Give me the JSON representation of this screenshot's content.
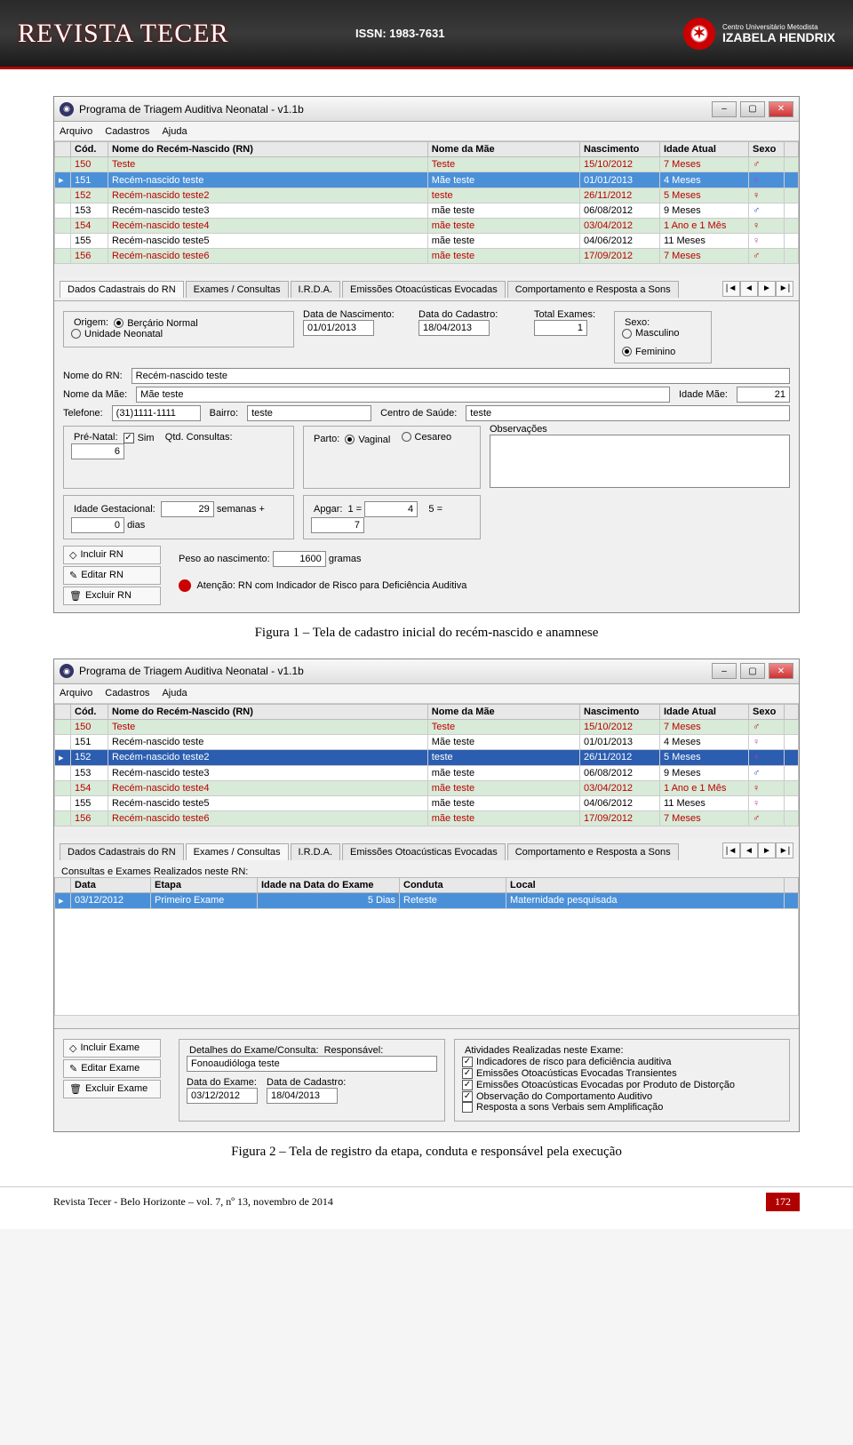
{
  "banner": {
    "title": "REVISTA TECER",
    "issn": "ISSN: 1983-7631",
    "logo_name": "IZABELA HENDRIX",
    "logo_sub": "Centro Universitário Metodista"
  },
  "fig1": {
    "window_title": "Programa de Triagem Auditiva Neonatal - v1.1b",
    "menus": [
      "Arquivo",
      "Cadastros",
      "Ajuda"
    ],
    "grid_headers": [
      "Cód.",
      "Nome do Recém-Nascido (RN)",
      "Nome da Mãe",
      "Nascimento",
      "Idade Atual",
      "Sexo"
    ],
    "grid_rows": [
      {
        "cod": "150",
        "nome": "Teste",
        "mae": "Teste",
        "nasc": "15/10/2012",
        "idade": "7 Meses",
        "sexo": "♂",
        "cls": "row-alt red-text",
        "sexcls": "sexo-m"
      },
      {
        "cod": "151",
        "nome": "Recém-nascido teste",
        "mae": "Mãe teste",
        "nasc": "01/01/2013",
        "idade": "4 Meses",
        "sexo": "♀",
        "cls": "row-sel",
        "sexcls": "sexo-f"
      },
      {
        "cod": "152",
        "nome": "Recém-nascido teste2",
        "mae": "teste",
        "nasc": "26/11/2012",
        "idade": "5 Meses",
        "sexo": "♀",
        "cls": "row-alt red-text",
        "sexcls": "sexo-f"
      },
      {
        "cod": "153",
        "nome": "Recém-nascido teste3",
        "mae": "mãe teste",
        "nasc": "06/08/2012",
        "idade": "9 Meses",
        "sexo": "♂",
        "cls": "",
        "sexcls": "sexo-m"
      },
      {
        "cod": "154",
        "nome": "Recém-nascido teste4",
        "mae": "mãe teste",
        "nasc": "03/04/2012",
        "idade": "1 Ano e 1 Mês",
        "sexo": "♀",
        "cls": "row-alt red-text",
        "sexcls": "sexo-f"
      },
      {
        "cod": "155",
        "nome": "Recém-nascido teste5",
        "mae": "mãe teste",
        "nasc": "04/06/2012",
        "idade": "11 Meses",
        "sexo": "♀",
        "cls": "",
        "sexcls": "sexo-f"
      },
      {
        "cod": "156",
        "nome": "Recém-nascido teste6",
        "mae": "mãe teste",
        "nasc": "17/09/2012",
        "idade": "7 Meses",
        "sexo": "♂",
        "cls": "row-alt red-text",
        "sexcls": "sexo-m"
      }
    ],
    "tabs": [
      "Dados Cadastrais do RN",
      "Exames / Consultas",
      "I.R.D.A.",
      "Emissões Otoacústicas Evocadas",
      "Comportamento e Resposta a Sons"
    ],
    "active_tab": 0,
    "form": {
      "origem_legend": "Origem:",
      "bercario": "Berçário Normal",
      "unidade": "Unidade Neonatal",
      "data_nasc_lbl": "Data de Nascimento:",
      "data_nasc": "01/01/2013",
      "data_cad_lbl": "Data do Cadastro:",
      "data_cad": "18/04/2013",
      "total_exames_lbl": "Total Exames:",
      "total_exames": "1",
      "sexo_legend": "Sexo:",
      "masc": "Masculino",
      "fem": "Feminino",
      "nome_rn_lbl": "Nome do RN:",
      "nome_rn": "Recém-nascido teste",
      "nome_mae_lbl": "Nome da Mãe:",
      "nome_mae": "Mãe teste",
      "idade_mae_lbl": "Idade Mãe:",
      "idade_mae": "21",
      "telefone_lbl": "Telefone:",
      "telefone": "(31)1111-1111",
      "bairro_lbl": "Bairro:",
      "bairro": "teste",
      "centro_lbl": "Centro de Saúde:",
      "centro": "teste",
      "prenatal_legend": "Pré-Natal:",
      "sim": "Sim",
      "qtd_consultas_lbl": "Qtd. Consultas:",
      "qtd_consultas": "6",
      "parto_legend": "Parto:",
      "vaginal": "Vaginal",
      "cesareo": "Cesareo",
      "obs_lbl": "Observações",
      "idade_gest_legend": "Idade Gestacional:",
      "idade_gest_sem": "29",
      "semanas": "semanas +",
      "idade_gest_dias": "0",
      "dias": "dias",
      "apgar_legend": "Apgar:",
      "apgar1_lbl": "1 =",
      "apgar1": "4",
      "apgar5_lbl": "5 =",
      "apgar5": "7",
      "peso_lbl": "Peso ao nascimento:",
      "peso": "1600",
      "gramas": "gramas",
      "incluir": "Incluir RN",
      "editar": "Editar RN",
      "excluir": "Excluir RN",
      "warn": "Atenção: RN com Indicador de Risco para Deficiência Auditiva"
    },
    "caption": "Figura 1 – Tela de cadastro inicial do recém-nascido e anamnese"
  },
  "fig2": {
    "window_title": "Programa de Triagem Auditiva Neonatal - v1.1b",
    "menus": [
      "Arquivo",
      "Cadastros",
      "Ajuda"
    ],
    "grid_headers": [
      "Cód.",
      "Nome do Recém-Nascido (RN)",
      "Nome da Mãe",
      "Nascimento",
      "Idade Atual",
      "Sexo"
    ],
    "grid_rows": [
      {
        "cod": "150",
        "nome": "Teste",
        "mae": "Teste",
        "nasc": "15/10/2012",
        "idade": "7 Meses",
        "sexo": "♂",
        "cls": "row-alt red-text",
        "sexcls": "sexo-m"
      },
      {
        "cod": "151",
        "nome": "Recém-nascido teste",
        "mae": "Mãe teste",
        "nasc": "01/01/2013",
        "idade": "4 Meses",
        "sexo": "♀",
        "cls": "",
        "sexcls": "sexo-f"
      },
      {
        "cod": "152",
        "nome": "Recém-nascido teste2",
        "mae": "teste",
        "nasc": "26/11/2012",
        "idade": "5 Meses",
        "sexo": "♀",
        "cls": "row-alt sel2",
        "sexcls": "sexo-f"
      },
      {
        "cod": "153",
        "nome": "Recém-nascido teste3",
        "mae": "mãe teste",
        "nasc": "06/08/2012",
        "idade": "9 Meses",
        "sexo": "♂",
        "cls": "",
        "sexcls": "sexo-m"
      },
      {
        "cod": "154",
        "nome": "Recém-nascido teste4",
        "mae": "mãe teste",
        "nasc": "03/04/2012",
        "idade": "1 Ano e 1 Mês",
        "sexo": "♀",
        "cls": "row-alt red-text",
        "sexcls": "sexo-f"
      },
      {
        "cod": "155",
        "nome": "Recém-nascido teste5",
        "mae": "mãe teste",
        "nasc": "04/06/2012",
        "idade": "11 Meses",
        "sexo": "♀",
        "cls": "",
        "sexcls": "sexo-f"
      },
      {
        "cod": "156",
        "nome": "Recém-nascido teste6",
        "mae": "mãe teste",
        "nasc": "17/09/2012",
        "idade": "7 Meses",
        "sexo": "♂",
        "cls": "row-alt red-text",
        "sexcls": "sexo-m"
      }
    ],
    "tabs": [
      "Dados Cadastrais do RN",
      "Exames / Consultas",
      "I.R.D.A.",
      "Emissões Otoacústicas Evocadas",
      "Comportamento e Resposta a Sons"
    ],
    "active_tab": 1,
    "sub_label": "Consultas e Exames Realizados neste RN:",
    "sub_headers": [
      "Data",
      "Etapa",
      "Idade na Data do Exame",
      "Conduta",
      "Local"
    ],
    "sub_row": {
      "data": "03/12/2012",
      "etapa": "Primeiro Exame",
      "idade": "5 Dias",
      "conduta": "Reteste",
      "local": "Maternidade pesquisada"
    },
    "form": {
      "incluir": "Incluir Exame",
      "editar": "Editar Exame",
      "excluir": "Excluir Exame",
      "detalhes_legend": "Detalhes do Exame/Consulta:",
      "resp_lbl": "Responsável:",
      "resp": "Fonoaudióloga teste",
      "dataex_lbl": "Data do Exame:",
      "dataex": "03/12/2012",
      "datacad_lbl": "Data de Cadastro:",
      "datacad": "18/04/2013",
      "ativ_legend": "Atividades Realizadas neste Exame:",
      "a1": "Indicadores de risco para deficiência auditiva",
      "a2": "Emissões Otoacústicas Evocadas Transientes",
      "a3": "Emissões Otoacústicas Evocadas por Produto de Distorção",
      "a4": "Observação do Comportamento Auditivo",
      "a5": "Resposta a sons Verbais sem Amplificação"
    },
    "caption": "Figura 2 – Tela de registro da etapa, conduta e responsável pela execução"
  },
  "footer": {
    "text": "Revista Tecer - Belo Horizonte – vol. 7, nº 13, novembro de 2014",
    "page": "172"
  }
}
